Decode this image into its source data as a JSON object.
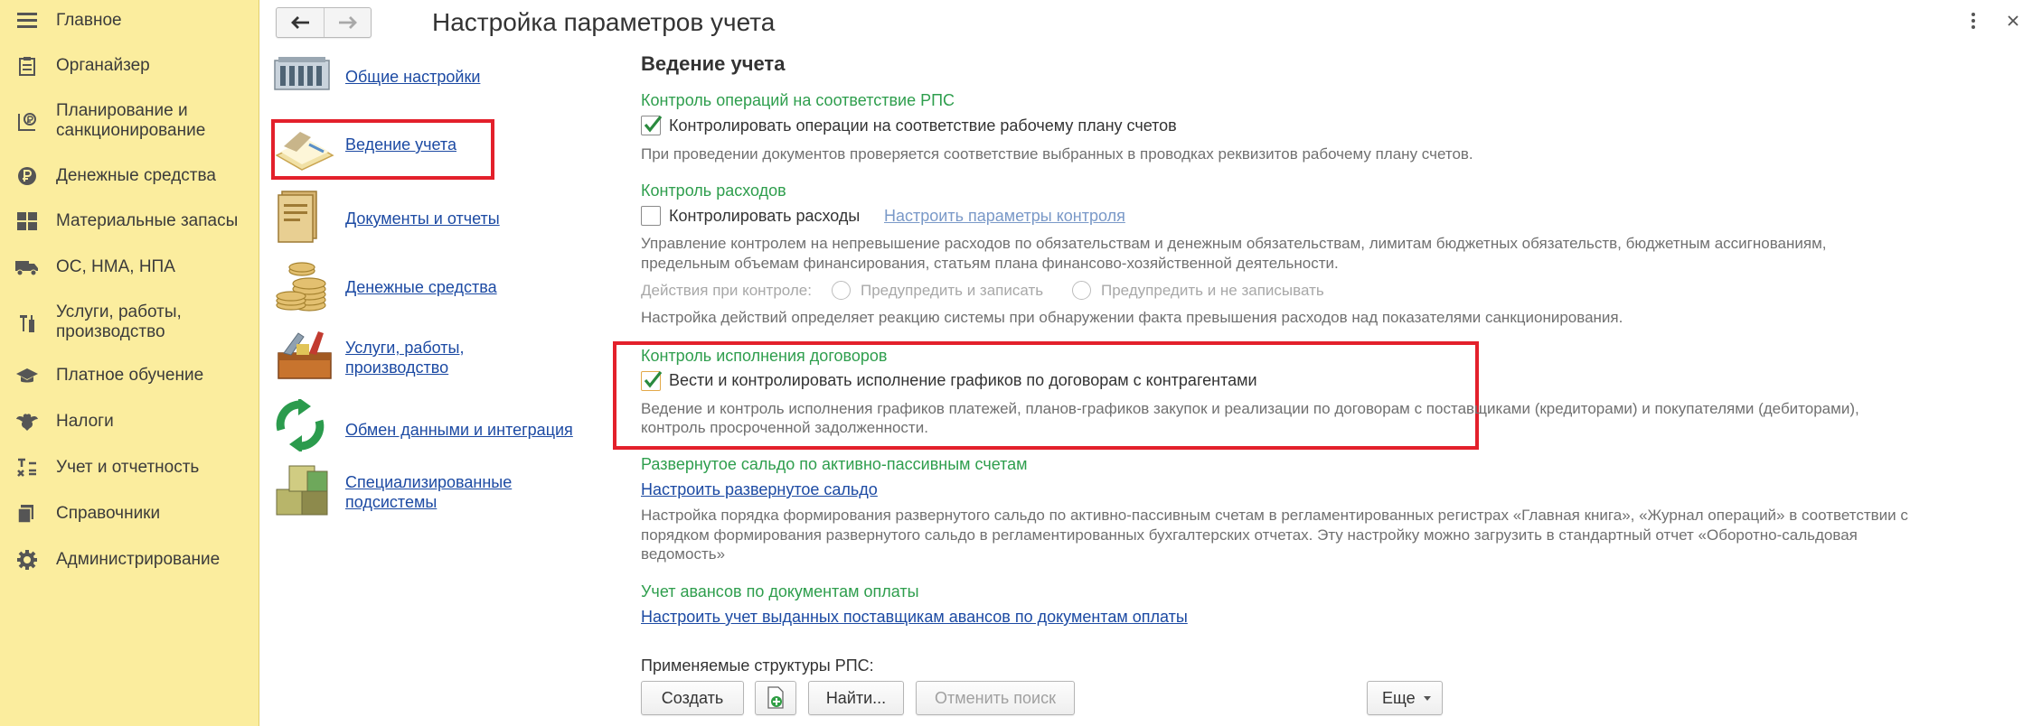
{
  "sidebar": {
    "items": [
      {
        "label": "Главное",
        "icon": "menu-icon"
      },
      {
        "label": "Органайзер",
        "icon": "clipboard-icon"
      },
      {
        "label": "Планирование и",
        "label2": "санкционирование",
        "icon": "planning-icon"
      },
      {
        "label": "Денежные средства",
        "icon": "ruble-coin-icon"
      },
      {
        "label": "Материальные запасы",
        "icon": "grid-icon"
      },
      {
        "label": "ОС, НМА, НПА",
        "icon": "truck-icon"
      },
      {
        "label": "Услуги, работы,",
        "label2": "производство",
        "icon": "tools-icon"
      },
      {
        "label": "Платное обучение",
        "icon": "graduation-cap-icon"
      },
      {
        "label": "Налоги",
        "icon": "eagle-emblem-icon"
      },
      {
        "label": "Учет и отчетность",
        "icon": "accounting-icon"
      },
      {
        "label": "Справочники",
        "icon": "books-icon"
      },
      {
        "label": "Администрирование",
        "icon": "gear-icon"
      }
    ]
  },
  "header": {
    "title": "Настройка параметров учета",
    "back": "back-arrow-icon",
    "forward": "forward-arrow-icon"
  },
  "sections": [
    {
      "label": "Общие настройки",
      "icon": "building-icon"
    },
    {
      "label": "Ведение учета",
      "icon": "ledger-icon"
    },
    {
      "label": "Документы и отчеты",
      "icon": "document-folder-icon"
    },
    {
      "label": "Денежные средства",
      "icon": "coins-stack-icon"
    },
    {
      "label": "Услуги, работы,",
      "label2": "производство",
      "icon": "toolbox-icon"
    },
    {
      "label": "Обмен данными и интеграция",
      "icon": "exchange-arrows-icon"
    },
    {
      "label": "Специализированные",
      "label2": "подсистемы",
      "icon": "cubes-icon"
    }
  ],
  "main": {
    "title": "Ведение учета",
    "rps": {
      "group": "Контроль операций на соответствие РПС",
      "checkbox_label": "Контролировать операции на соответствие рабочему плану счетов",
      "checked": true,
      "hint": "При проведении документов проверяется соответствие выбранных в проводках реквизитов рабочему плану счетов."
    },
    "expenses": {
      "group": "Контроль расходов",
      "checkbox_label": "Контролировать расходы",
      "checked": false,
      "link": "Настроить параметры контроля",
      "hint1": "Управление контролем на непревышение расходов по обязательствам и денежным обязательствам, лимитам бюджетных обязательств, бюджетным ассигнованиям,",
      "hint2": "предельным объемам финансирования, статьям плана финансово-хозяйственной деятельности.",
      "actions_label": "Действия при контроле:",
      "option1": "Предупредить и записать",
      "option2": "Предупредить и не записывать",
      "hint3": "Настройка действий определяет реакцию системы при обнаружении факта превышения расходов над показателями санкционирования."
    },
    "contracts": {
      "group": "Контроль исполнения договоров",
      "checkbox_label": "Вести и контролировать исполнение графиков по договорам с контрагентами",
      "checked": true,
      "hint1": "Ведение и контроль исполнения графиков платежей, планов-графиков закупок и реализации по договорам с поставщиками (кредиторами) и покупателями (дебиторами),",
      "hint2": "контроль просроченной задолженности."
    },
    "balance": {
      "group": "Развернутое сальдо по активно-пассивным счетам",
      "link": "Настроить развернутое сальдо",
      "hint1": "Настройка порядка формирования развернутого сальдо по активно-пассивным счетам в регламентированных регистрах «Главная книга», «Журнал операций» в соответствии с",
      "hint2": "порядком формирования развернутого сальдо в регламентированных бухгалтерских отчетах. Эту настройку можно загрузить в стандартный отчет «Оборотно-сальдовая",
      "hint3": "ведомость»"
    },
    "advances": {
      "group": "Учет авансов по документам оплаты",
      "link": "Настроить учет выданных поставщикам авансов по документам оплаты"
    },
    "structures": {
      "label": "Применяемые структуры РПС:",
      "create": "Создать",
      "find": "Найти...",
      "cancel_search": "Отменить поиск",
      "more": "Еще"
    }
  },
  "colors": {
    "sidebar_bg": "#fbed9e",
    "group_green": "#2e9e4d",
    "link_blue": "#1c4aa3",
    "highlight_red": "#e3202b"
  }
}
